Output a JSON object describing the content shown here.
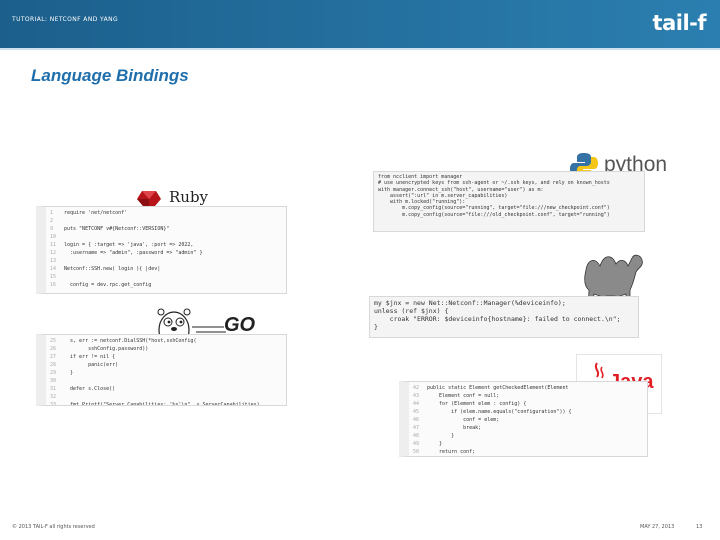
{
  "header": {
    "label": "TUTORIAL: NETCONF AND YANG",
    "logo": "tail-f"
  },
  "title": "Language Bindings",
  "ruby": {
    "brand": "Ruby",
    "tagline": "A PROGRAMMER'S BEST FRIEND",
    "lines": [
      {
        "n": "1",
        "t": "require 'net/netconf'"
      },
      {
        "n": "2",
        "t": ""
      },
      {
        "n": "9",
        "t": "puts \"NETCONF v#{Netconf::VERSION}\""
      },
      {
        "n": "10",
        "t": ""
      },
      {
        "n": "11",
        "t": "login = { :target => 'java', :port => 2022,"
      },
      {
        "n": "12",
        "t": "  :username => \"admin\", :password => \"admin\" }"
      },
      {
        "n": "13",
        "t": ""
      },
      {
        "n": "14",
        "t": "Netconf::SSH.new( login ){ |dev|"
      },
      {
        "n": "15",
        "t": ""
      },
      {
        "n": "16",
        "t": "  config = dev.rpc.get_config"
      }
    ]
  },
  "python": {
    "brand": "python",
    "lines": [
      "from ncclient import manager",
      "",
      "# use unencrypted keys from ssh-agent or ~/.ssh keys, and rely on known_hosts",
      "with manager.connect_ssh(\"host\", username=\"user\") as m:",
      "    assert(\":url\" in m.server_capabilities)",
      "    with m.locked(\"running\"):",
      "        m.copy_config(source=\"running\", target=\"file:///new_checkpoint.conf\")",
      "        m.copy_config(source=\"file:///old_checkpoint.conf\", target=\"running\")"
    ]
  },
  "perl": {
    "lines": [
      "my $jnx = new Net::Netconf::Manager(%deviceinfo);",
      "unless (ref $jnx) {",
      "    croak \"ERROR: $deviceinfo{hostname}: failed to connect.\\n\";",
      "}"
    ]
  },
  "go": {
    "brand": "GO",
    "lines": [
      {
        "n": "25",
        "t": "  s, err := netconf.DialSSH(*host,sshConfig("
      },
      {
        "n": "26",
        "t": "        sshConfig.password))"
      },
      {
        "n": "27",
        "t": "  if err != nil {"
      },
      {
        "n": "28",
        "t": "        panic(err)"
      },
      {
        "n": "29",
        "t": "  }"
      },
      {
        "n": "30",
        "t": ""
      },
      {
        "n": "31",
        "t": "  defer s.Close()"
      },
      {
        "n": "32",
        "t": ""
      },
      {
        "n": "33",
        "t": "  fmt.Printf(\"Server Capabilities: '%s'\\n\", s.ServerCapabilities)"
      },
      {
        "n": "34",
        "t": "  fmt.Printf(\"Session Id: %d\\n\\n\", s.SessionID)"
      }
    ]
  },
  "java": {
    "brand": "Java",
    "lines": [
      {
        "n": "42",
        "t": "public static Element getCheckedElement(Element"
      },
      {
        "n": "43",
        "t": "    Element conf = null;"
      },
      {
        "n": "44",
        "t": "    for (Element elem : config) {"
      },
      {
        "n": "45",
        "t": "        if (elem.name.equals(\"configuration\")) {"
      },
      {
        "n": "46",
        "t": "            conf = elem;"
      },
      {
        "n": "47",
        "t": "            break;"
      },
      {
        "n": "48",
        "t": "        }"
      },
      {
        "n": "49",
        "t": "    }"
      },
      {
        "n": "50",
        "t": "    return conf;"
      },
      {
        "n": "51",
        "t": "}"
      }
    ]
  },
  "footer": {
    "copyright": "© 2013 TAIL-F all rights reserved",
    "date": "MAY 27, 2013",
    "page": "13"
  },
  "colors": {
    "header": "#1c5f8c",
    "title": "#1f6fad",
    "ruby": "#b8141b",
    "python_blue": "#3572a5",
    "python_yellow": "#f5c518",
    "java_red": "#e11f25",
    "java_blue": "#4a75a8"
  }
}
